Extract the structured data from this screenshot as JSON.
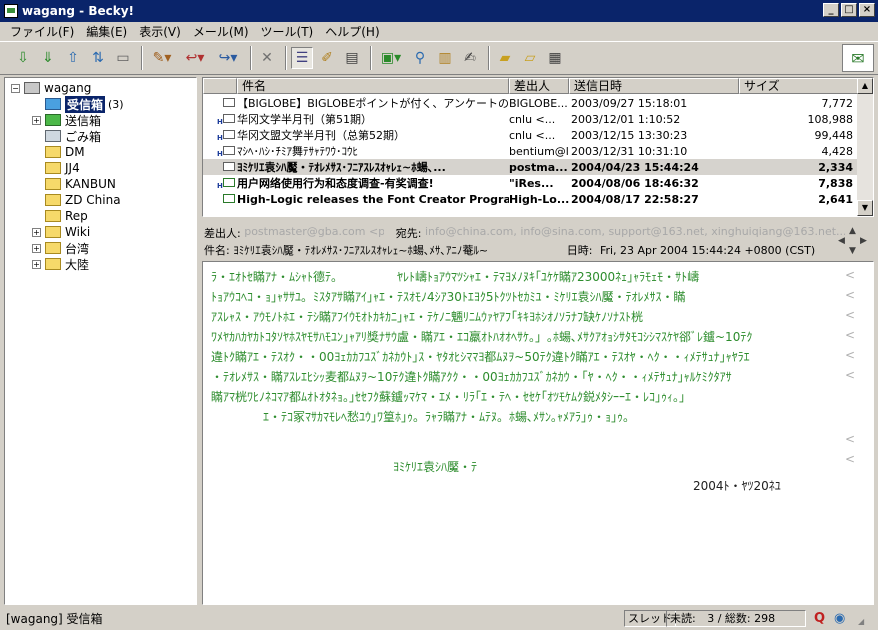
{
  "window": {
    "title": "wagang - Becky!"
  },
  "menu": [
    "ファイル(F)",
    "編集(E)",
    "表示(V)",
    "メール(M)",
    "ツール(T)",
    "ヘルプ(H)"
  ],
  "toolbar_icons": [
    "check-mail-icon",
    "receive-icon",
    "send-icon",
    "send-receive-icon",
    "compose-icon",
    "reply-icon",
    "forward-icon",
    "reply-all-icon",
    "delete-icon",
    "thread-view-icon",
    "edit-icon",
    "properties-icon",
    "filter-icon",
    "find-icon",
    "address-book-icon",
    "memo-icon",
    "new-folder-icon",
    "move-folder-icon",
    "layout-icon"
  ],
  "folders": [
    {
      "label": "wagang",
      "icon": "computer-icon",
      "expander": "−",
      "level": 0
    },
    {
      "label": "受信箱",
      "icon": "inbox-icon",
      "count": "(3)",
      "level": 1,
      "selected": true
    },
    {
      "label": "送信箱",
      "icon": "outbox-icon",
      "expander": "+",
      "level": 1
    },
    {
      "label": "ごみ箱",
      "icon": "trash-icon",
      "level": 1
    },
    {
      "label": "DM",
      "icon": "folder-icon",
      "level": 1
    },
    {
      "label": "JJ4",
      "icon": "folder-icon",
      "level": 1
    },
    {
      "label": "KANBUN",
      "icon": "folder-icon",
      "level": 1
    },
    {
      "label": "ZD China",
      "icon": "folder-icon",
      "level": 1
    },
    {
      "label": "Rep",
      "icon": "folder-icon",
      "level": 1
    },
    {
      "label": "Wiki",
      "icon": "folder-icon",
      "expander": "+",
      "level": 1
    },
    {
      "label": "台湾",
      "icon": "folder-icon",
      "expander": "+",
      "level": 1
    },
    {
      "label": "大陸",
      "icon": "folder-icon",
      "expander": "+",
      "level": 1
    }
  ],
  "list": {
    "columns": [
      "件名",
      "差出人",
      "送信日時",
      "サイズ"
    ],
    "rows": [
      {
        "subject": "【BIGLOBE】BIGLOBEポイントが付く、アンケートのお願い",
        "from": "BIGLOBE...",
        "date": "2003/09/27 15:18:01",
        "size": "7,772",
        "bold": false,
        "h": false
      },
      {
        "subject": "华冈文学半月刊（第51期）",
        "from": "cnlu <...",
        "date": "2003/12/01 1:10:52",
        "size": "108,988",
        "bold": false,
        "h": true
      },
      {
        "subject": "华冈文盟文学半月刊（总第52期）",
        "from": "cnlu <...",
        "date": "2003/12/15 13:30:23",
        "size": "99,448",
        "bold": false,
        "h": true
      },
      {
        "subject": "ﾏｼﾍ･ﾊｼ･ﾁﾐｱ舞ﾃｻｬﾃﾜｳ･ｺｳﾋ",
        "from": "bentium@l...",
        "date": "2003/12/31 10:31:10",
        "size": "4,428",
        "bold": false,
        "h": true
      },
      {
        "subject": "ﾖﾐｹﾘｴ袁ｼﾊ魘・ﾃｵﾚﾒｻｽ･ﾌﾆｱｽﾚｽｵｬﾚｪ~ﾎ蝪､...",
        "from": "postma...",
        "date": "2004/04/23 15:44:24",
        "size": "2,334",
        "bold": true,
        "h": false
      },
      {
        "subject": "用户网络使用行为和态度调查-有奖调查!",
        "from": "\"iRes...",
        "date": "2004/08/06 18:46:32",
        "size": "7,838",
        "bold": true,
        "h": true
      },
      {
        "subject": "High-Logic releases the Font Creator Progra...",
        "from": "High-Lo...",
        "date": "2004/08/17 22:58:27",
        "size": "2,641",
        "bold": true,
        "h": false
      }
    ]
  },
  "header": {
    "from_label": "差出人:",
    "from_value": "postmaster@gba.com <postmaster@gba.com>",
    "to_label": "宛先:",
    "to_value": "info@china.com, info@sina.com, support@163.net, xinghuiqiang@163.net...",
    "subject_label": "件名:",
    "subject_value": "ﾖﾐｹﾘｴ袁ｼﾊ魘・ﾃｵﾚﾒｻｽ･ﾌﾆｱｽﾚｽｵｬﾚｪ~ﾎ蝪､ﾒｻ､ｱﾆﾉ菴ﾙ~",
    "date_label": "日時:",
    "date_value": "Fri, 23 Apr 2004 15:44:24 +0800 (CST)"
  },
  "body": {
    "lines": [
      "ﾗ・ｴｵﾄｾ瞞ｱﾅ・ﾑｼｬﾄ德ﾃ。　　　　　ﾔﾚﾄ嶹ﾄｮｱｳﾏﾂｼｬｴ・ﾃﾏﾖﾒﾉﾇｷ｢ﾕｹｹ瞞ｱ23000ﾈｪ｣ｬﾗﾓｪﾓ・ｻﾄ嶹",
      "ﾄｮｱｳｺﾍｺ・ｮ｣ｬｻｻﾕ。ﾐｽﾀｱｻ瞞ｱｲ｣ｬｴ・ﾃｽｵﾓﾉ4ｼｱ30ﾄｴﾖｸ5ﾄｸﾂﾄｾｶﾐﾕ・ﾐｹﾘｴ袁ｼﾊ魘・ﾃｵﾚﾒｻｽ・瞞",
      "ｱｽﾚｬｽ・ｱｳﾓﾉﾄﾎｴ・ﾃｼ瞞ｱﾌｲｳﾓｵﾄｶｷｶﾆ｣ｬｴ・ﾃｹﾉﾆ魎ﾘﾆﾑｳｧﾔｱﾌ｢ｷｷﾖﾎｼｵﾉｿﾗﾅﾌ缺ｹﾉｿﾅｽﾄ桄",
      "ﾜﾒﾔｶﾊｶﾔｶﾄｺﾀｿﾔﾎｽﾔﾓｻﾊﾓﾕﾝ｣ｬｱﾘ獎ﾅｻｳ盧・瞞ｱｴ・ｴｺ羸ｵﾄﾊｵｵﾍｻｹ。」｡ﾎ蝪､ﾒｻｸｱｵｮｼｻﾀﾓｺｼｼﾏｽｹﾔ郤ﾞﾚ鑪~10ﾃｸ",
      "違ﾄｸ瞞ｱｴ・ﾃｽｵｸ・・00ﾖｪｶｶﾌﾕｽﾞｶﾈｶｳﾄ｣ｽ・ﾔﾀｵﾋｼﾏﾏﾖ都ﾑﾇｦ~50ﾃｸ違ﾄｸ瞞ｱｴ・ﾃｽｵﾔ・ﾍｸ・・ｨﾒﾃｻｭﾅ｣ｬﾔﾗｴ",
      "・ﾃｵﾚﾒｻｽ・瞞ｱｽﾚｴﾋｼｯ麦都ﾑﾇｦ~10ﾃｸ違ﾄｸ瞞ｱｸｸ・・00ﾖｪｶｶﾌﾕｽﾞｶﾈｶｳ・｢ﾔ・ﾍｸ・・ｨﾒﾃｻｭﾅ｣ｬﾙｹﾐｸﾀｱｻ",
      "瞞ｱﾏ桄ﾜﾋﾉﾈｺﾏｱ都ﾑｵﾄｵﾀﾈｮ。｣ｾｾﾌｸ蘇鑪ｯﾏｹﾏ・ｴﾒ・ﾘﾗ｢ｴ・ﾃﾍ・ｾｾｹ｢ｵﾂﾓｹﾑｸ鋭ﾒﾀｼｰｰｴ・ﾚｺ｣ｩｨ。」",
      "ｴ・ﾃｺ冢ﾏｻｶﾏﾓﾚﾍ愁ﾕｳ｣ﾜ篁ﾎ｣ｩ。ﾗｬﾗ瞞ｱﾅ・ﾑﾃﾇ。ﾎ蝪､ﾒｻﾝ｡ｬﾒｱﾗ｣ｩ・ｮ｣ｩ。",
      "ﾖﾐｹﾘｴ袁ｼﾊ魘・ﾃ",
      "2004ﾄ・ﾔﾂ20ﾈﾕ"
    ]
  },
  "status": {
    "left": "[wagang] 受信箱",
    "thread": "スレッド",
    "unread_label": "未読:",
    "unread_value": "3 / 総数:  298"
  }
}
